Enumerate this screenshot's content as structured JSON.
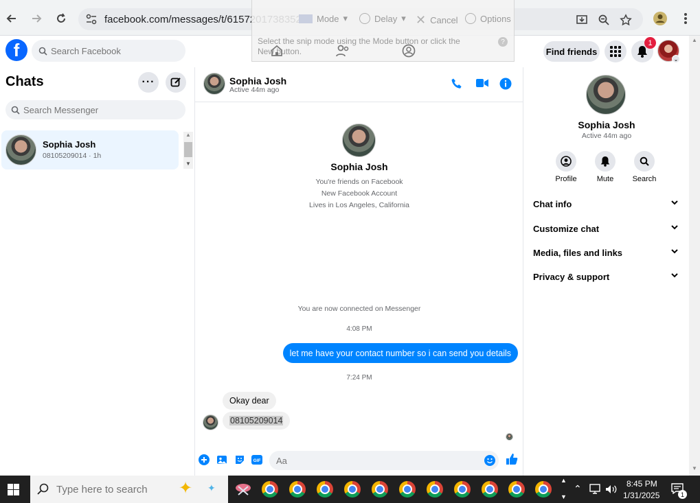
{
  "browser": {
    "url": "facebook.com/messages/t/61572017383529"
  },
  "snip": {
    "mode_label": "Mode",
    "delay_label": "Delay",
    "cancel_label": "Cancel",
    "options_label": "Options",
    "hint": "Select the snip mode using the Mode button or click the New button."
  },
  "fb": {
    "search_placeholder": "Search Facebook",
    "find_friends": "Find friends",
    "notification_count": "1"
  },
  "chats": {
    "title": "Chats",
    "search_placeholder": "Search Messenger",
    "items": [
      {
        "name": "Sophia Josh",
        "preview": "08105209014 · 1h"
      }
    ]
  },
  "conversation": {
    "name": "Sophia Josh",
    "status": "Active 44m ago",
    "intro_name": "Sophia Josh",
    "intro_lines": [
      "You're friends on Facebook",
      "New Facebook Account",
      "Lives in Los Angeles, California"
    ],
    "connected": "You are now connected on Messenger",
    "time1": "4:08 PM",
    "outgoing_1": "let me have your contact number so i can send you details",
    "time2": "7:24 PM",
    "incoming_1": "Okay dear",
    "incoming_2": "08105209014",
    "input_placeholder": "Aa"
  },
  "info": {
    "name": "Sophia Josh",
    "status": "Active 44m ago",
    "actions": [
      "Profile",
      "Mute",
      "Search"
    ],
    "sections": [
      "Chat info",
      "Customize chat",
      "Media, files and links",
      "Privacy & support"
    ]
  },
  "taskbar": {
    "search_placeholder": "Type here to search",
    "time": "8:45 PM",
    "date": "1/31/2025",
    "notification_count": "1"
  },
  "colors": {
    "brand": "#0866ff",
    "messenger_blue": "#0084ff",
    "selected_chat": "#ebf5ff"
  }
}
